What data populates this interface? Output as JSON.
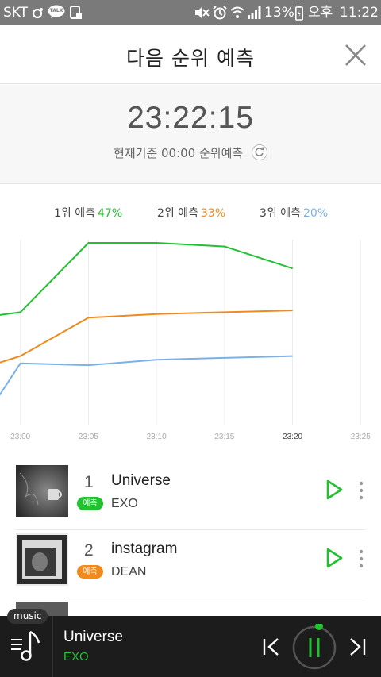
{
  "status_bar": {
    "carrier": "SKT",
    "kakaotalk_label": "TALK",
    "battery": "13%",
    "ampm": "오후",
    "time": "11:22",
    "icons": [
      "kakaostory-icon",
      "kakaotalk-icon",
      "notification-icon",
      "mute-icon",
      "alarm-icon",
      "wifi-icon",
      "signal-icon",
      "battery-icon"
    ]
  },
  "header": {
    "title": "다음 순위 예측",
    "close_icon": "close-icon"
  },
  "timer": {
    "value": "23:22:15",
    "caption": "현재기준 00:00 순위예측",
    "refresh_icon": "refresh-icon"
  },
  "legend": [
    {
      "label": "1위 예측",
      "percent": "47%",
      "color": "#21c131"
    },
    {
      "label": "2위 예측",
      "percent": "33%",
      "color": "#f08a1f"
    },
    {
      "label": "3위 예측",
      "percent": "20%",
      "color": "#7ab1e8"
    }
  ],
  "chart_data": {
    "type": "line",
    "x": [
      "22:57",
      "23:00",
      "23:05",
      "23:10",
      "23:15",
      "23:20"
    ],
    "x_ticks": [
      "23:00",
      "23:05",
      "23:10",
      "23:15",
      "23:20",
      "23:25"
    ],
    "xlim": [
      "22:58:30",
      "23:26:30"
    ],
    "ylim": [
      0,
      100
    ],
    "grid": "vertical",
    "legend_placement": "top",
    "series": [
      {
        "name": "1위 예측",
        "color": "#21c131",
        "values": [
          59,
          62,
          100,
          100,
          98,
          86
        ]
      },
      {
        "name": "2위 예측",
        "color": "#f08a1f",
        "values": [
          31,
          38,
          59,
          61,
          62,
          63
        ]
      },
      {
        "name": "3위 예측",
        "color": "#7ab1e8",
        "values": [
          0,
          34,
          33,
          36,
          37,
          38
        ]
      }
    ]
  },
  "songs": [
    {
      "rank": "1",
      "title": "Universe",
      "artist": "EXO",
      "badge": "예측",
      "badge_color": "#21c131",
      "play_icon": "play-icon",
      "more_icon": "more-vertical-icon"
    },
    {
      "rank": "2",
      "title": "instagram",
      "artist": "DEAN",
      "badge": "예측",
      "badge_color": "#f08a1f",
      "play_icon": "play-icon",
      "more_icon": "more-vertical-icon"
    }
  ],
  "player": {
    "tag": "music",
    "title": "Universe",
    "artist": "EXO",
    "icons": [
      "music-note-icon",
      "previous-icon",
      "pause-icon",
      "next-icon"
    ],
    "accent": "#21c131"
  }
}
